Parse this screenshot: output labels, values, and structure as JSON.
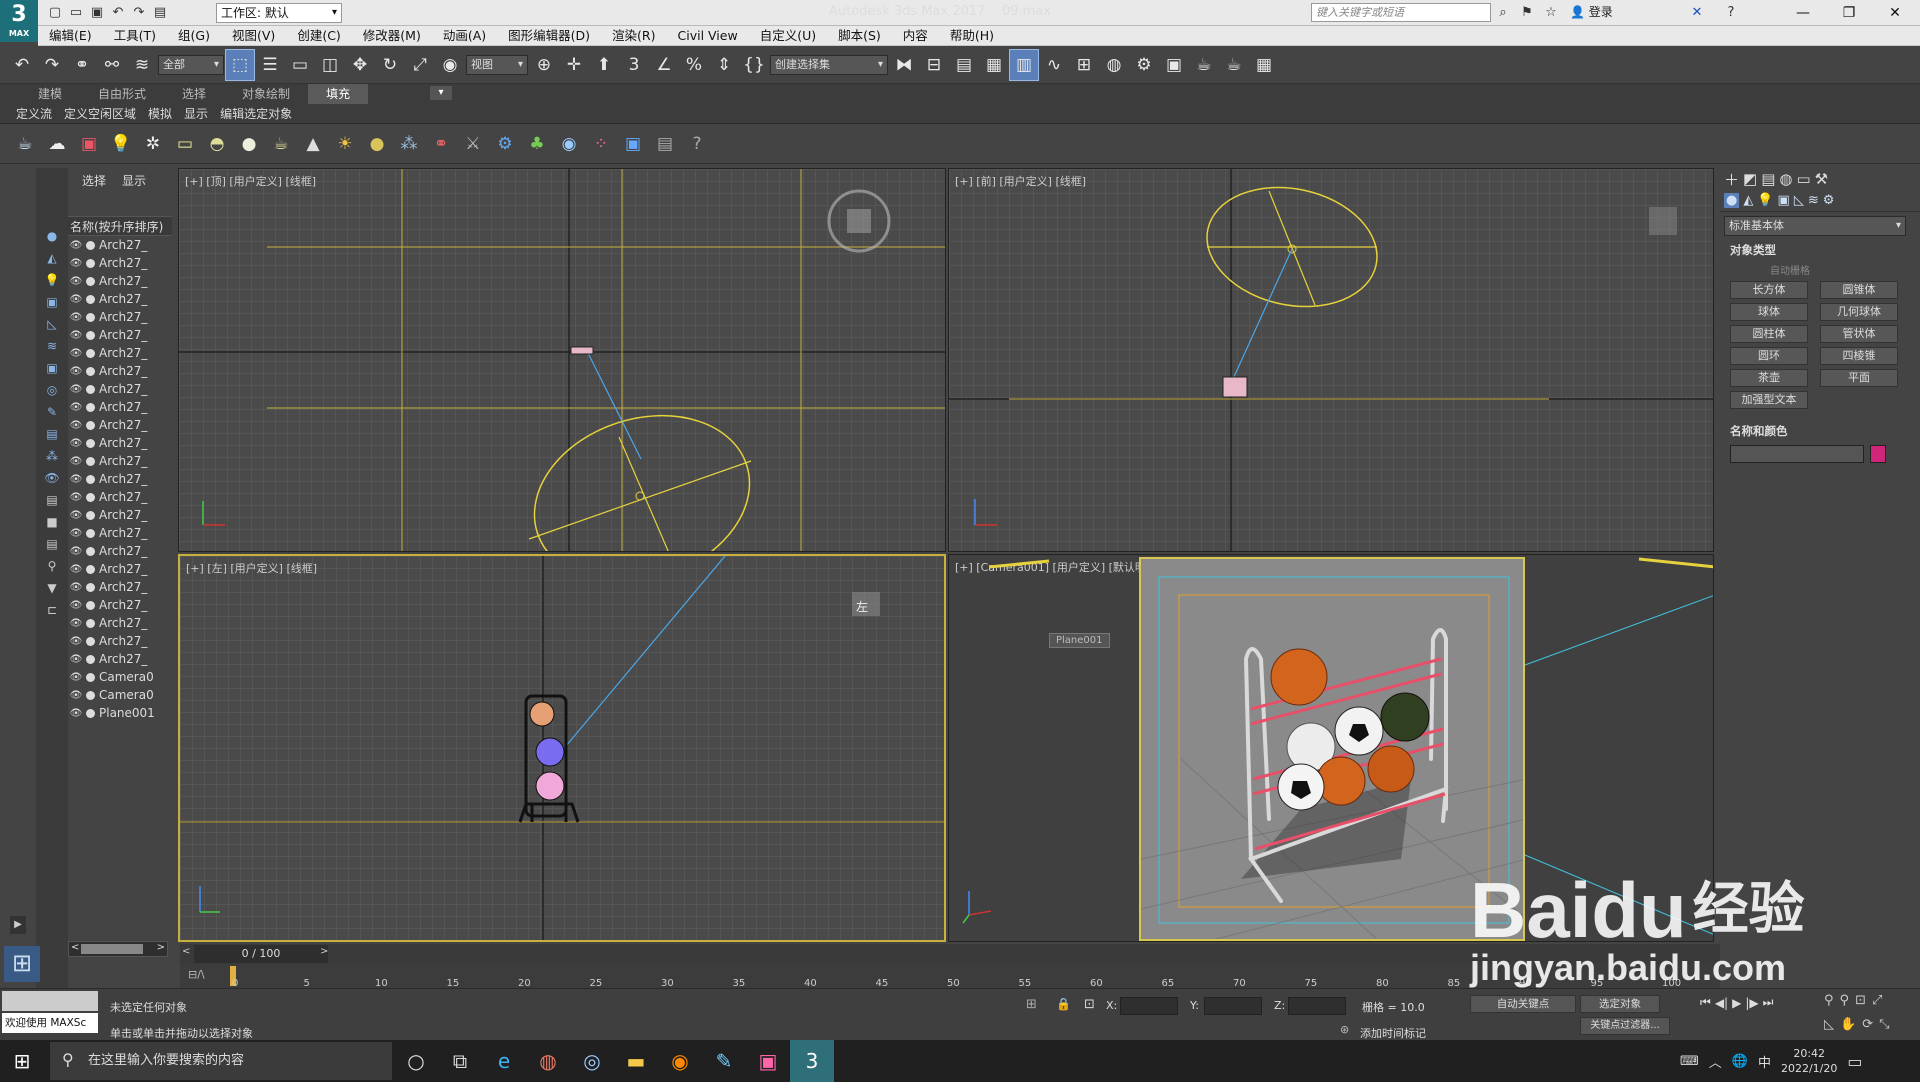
{
  "app": {
    "title": "Autodesk 3ds Max 2017",
    "file": "09.max",
    "workspace": "工作区: 默认",
    "search_placeholder": "键入关键字或短语",
    "login": "登录",
    "logo": "3",
    "logo_sub": "MAX"
  },
  "menu": [
    "编辑(E)",
    "工具(T)",
    "组(G)",
    "视图(V)",
    "创建(C)",
    "修改器(M)",
    "动画(A)",
    "图形编辑器(D)",
    "渲染(R)",
    "Civil View",
    "自定义(U)",
    "脚本(S)",
    "内容",
    "帮助(H)"
  ],
  "toolbar": {
    "filter": "全部",
    "coord": "视图",
    "selection_set": "创建选择集"
  },
  "ribbon": {
    "tabs": [
      "建模",
      "自由形式",
      "选择",
      "对象绘制",
      "填充"
    ],
    "selected": "填充"
  },
  "subribbon": [
    "定义流",
    "定义空闲区域",
    "模拟",
    "显示",
    "编辑选定对象"
  ],
  "explorer": {
    "tabs": [
      "选择",
      "显示"
    ],
    "header": "名称(按升序排序)",
    "items": [
      "Arch27_",
      "Arch27_",
      "Arch27_",
      "Arch27_",
      "Arch27_",
      "Arch27_",
      "Arch27_",
      "Arch27_",
      "Arch27_",
      "Arch27_",
      "Arch27_",
      "Arch27_",
      "Arch27_",
      "Arch27_",
      "Arch27_",
      "Arch27_",
      "Arch27_",
      "Arch27_",
      "Arch27_",
      "Arch27_",
      "Arch27_",
      "Arch27_",
      "Arch27_",
      "Arch27_",
      "Camera0",
      "Camera0",
      "Plane001"
    ]
  },
  "viewports": {
    "top": "[+] [顶] [用户定义] [线框]",
    "front": "[+] [前] [用户定义] [线框]",
    "left": "[+] [左] [用户定义] [线框]",
    "camera": "[+] [Camera001] [用户定义] [默认明暗处理]",
    "camera_tag": "Plane001",
    "nav_left": "左"
  },
  "cmdpanel": {
    "category": "标准基本体",
    "object_type": "对象类型",
    "autogrid": "自动栅格",
    "buttons": [
      "长方体",
      "圆锥体",
      "球体",
      "几何球体",
      "圆柱体",
      "管状体",
      "圆环",
      "四棱锥",
      "茶壶",
      "平面",
      "加强型文本"
    ],
    "name_color": "名称和颜色",
    "swatch": "#d0267a"
  },
  "time": {
    "frame": "0 / 100",
    "ticks": [
      "0",
      "5",
      "10",
      "15",
      "20",
      "25",
      "30",
      "35",
      "40",
      "45",
      "50",
      "55",
      "60",
      "65",
      "70",
      "75",
      "80",
      "85",
      "90",
      "95",
      "100"
    ]
  },
  "status": {
    "msg1": "未选定任何对象",
    "msg2": "单击或单击并拖动以选择对象",
    "welcome": "欢迎使用 MAXSc",
    "x_label": "X:",
    "y_label": "Y:",
    "z_label": "Z:",
    "grid": "栅格 = 10.0",
    "add_time_tag": "添加时间标记",
    "auto_key": "自动关键点",
    "set_key": "选定对象",
    "key_filters": "关键点过滤器..."
  },
  "taskbar": {
    "search": "在这里输入你要搜索的内容",
    "time": "20:42",
    "date": "2022/1/20",
    "ime": "中"
  },
  "watermark": {
    "brand": "Baidu",
    "sub": "经验",
    "url": "jingyan.baidu.com"
  }
}
